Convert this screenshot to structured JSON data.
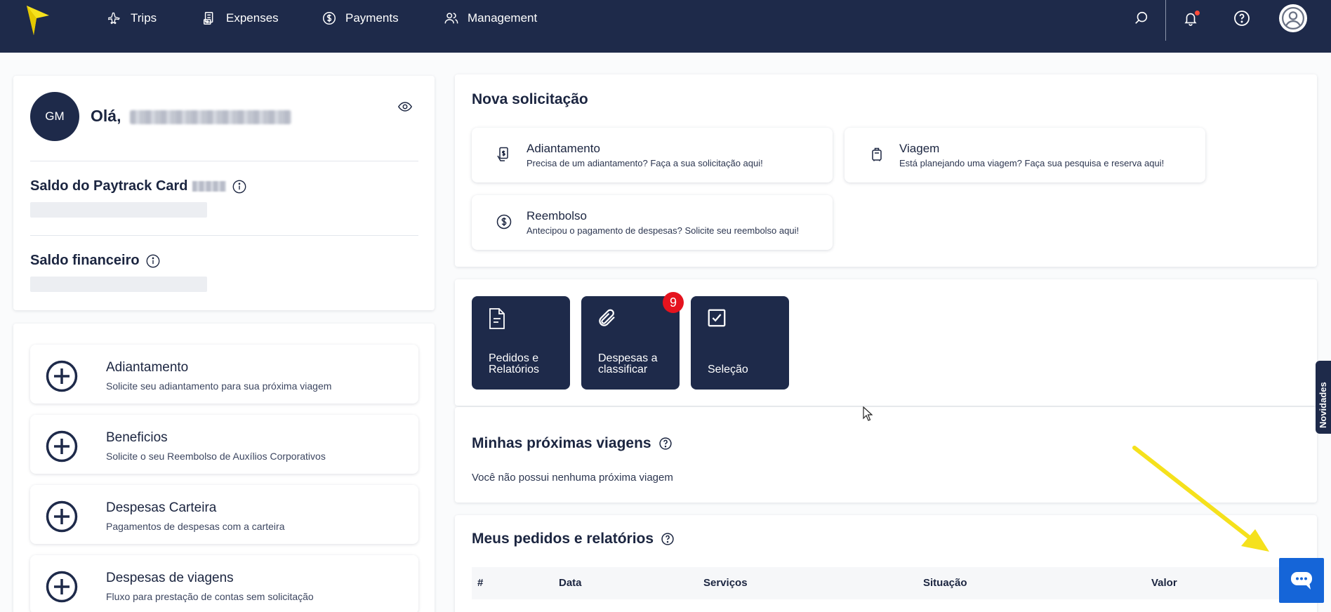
{
  "nav": {
    "items": [
      {
        "label": "Trips",
        "icon": "plane-icon"
      },
      {
        "label": "Expenses",
        "icon": "receipt-icon"
      },
      {
        "label": "Payments",
        "icon": "dollar-circle-icon"
      },
      {
        "label": "Management",
        "icon": "users-icon"
      }
    ],
    "right_icons": [
      "search-icon",
      "bell-icon",
      "help-icon",
      "user-avatar-icon"
    ]
  },
  "profile": {
    "initials": "GM",
    "greeting": "Olá,",
    "card_balance_label": "Saldo do Paytrack Card",
    "financial_balance_label": "Saldo financeiro"
  },
  "actions": [
    {
      "title": "Adiantamento",
      "subtitle": "Solicite seu adiantamento para sua próxima viagem"
    },
    {
      "title": "Beneficios",
      "subtitle": "Solicite o seu Reembolso de Auxílios Corporativos"
    },
    {
      "title": "Despesas Carteira",
      "subtitle": "Pagamentos de despesas com a carteira"
    },
    {
      "title": "Despesas de viagens",
      "subtitle": "Fluxo para prestação de contas sem solicitação"
    }
  ],
  "nova": {
    "title": "Nova solicitação",
    "items": [
      {
        "title": "Adiantamento",
        "subtitle": "Precisa de um adiantamento? Faça a sua solicitação aqui!"
      },
      {
        "title": "Viagem",
        "subtitle": "Está planejando uma viagem? Faça sua pesquisa e reserva aqui!"
      },
      {
        "title": "Reembolso",
        "subtitle": "Antecipou o pagamento de despesas? Solicite seu reembolso aqui!"
      }
    ]
  },
  "quick": {
    "tiles": [
      {
        "label": "Pedidos e Relatórios"
      },
      {
        "label": "Despesas a classificar"
      },
      {
        "label": "Seleção"
      }
    ],
    "badge_count": "9"
  },
  "viagens": {
    "title": "Minhas próximas viagens",
    "empty": "Você não possui nenhuma próxima viagem"
  },
  "pedidos": {
    "title": "Meus pedidos e relatórios",
    "columns": [
      "#",
      "Data",
      "Serviços",
      "Situação",
      "Valor"
    ]
  },
  "novidades": "Novidades",
  "colors": {
    "navy": "#1e2a4a",
    "badge": "#e5131e",
    "chat": "#1565d8",
    "arrow": "#f5e11c"
  }
}
